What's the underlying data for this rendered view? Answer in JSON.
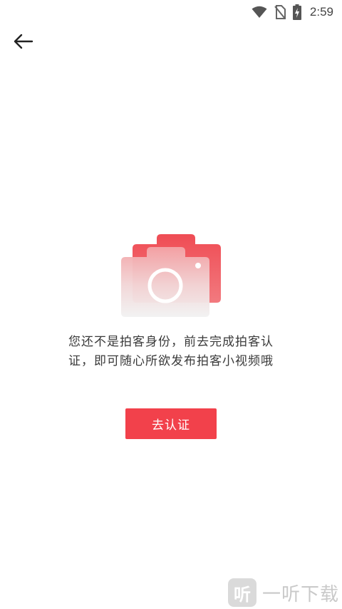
{
  "status_bar": {
    "time": "2:59",
    "icons": [
      "wifi-icon",
      "no-sim-icon",
      "battery-charging-icon"
    ]
  },
  "toolbar": {
    "back_icon": "arrow-left-icon"
  },
  "empty_state": {
    "illustration_icon": "camera-icon",
    "message": "您还不是拍客身份，前去完成拍客认证，即可随心所欲发布拍客小视频哦",
    "verify_button_label": "去认证"
  },
  "watermark": {
    "logo_glyph": "听",
    "text": "一听下载"
  },
  "colors": {
    "accent": "#f2414b",
    "background": "#ffffff",
    "text": "#3a3a3a"
  }
}
